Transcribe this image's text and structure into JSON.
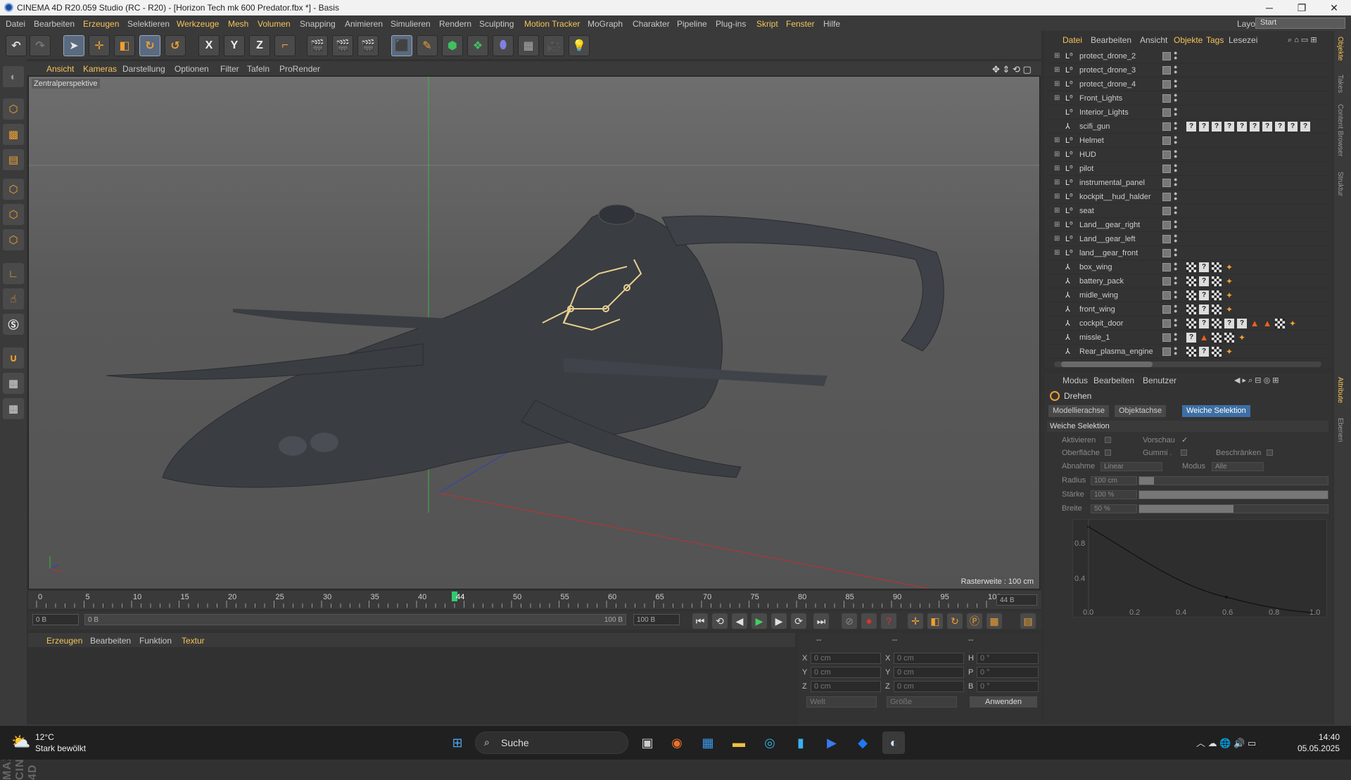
{
  "window": {
    "title": "CINEMA 4D R20.059 Studio (RC - R20) - [Horizon Tech mk 600 Predator.fbx *] - Basis",
    "minimize": "─",
    "maximize": "❐",
    "close": "✕"
  },
  "menu": [
    {
      "label": "Datei",
      "hl": false
    },
    {
      "label": "Bearbeiten",
      "hl": false
    },
    {
      "label": "Erzeugen",
      "hl": true
    },
    {
      "label": "Selektieren",
      "hl": false
    },
    {
      "label": "Werkzeuge",
      "hl": true
    },
    {
      "label": "Mesh",
      "hl": true
    },
    {
      "label": "Volumen",
      "hl": true
    },
    {
      "label": "Snapping",
      "hl": false
    },
    {
      "label": "Animieren",
      "hl": false
    },
    {
      "label": "Simulieren",
      "hl": false
    },
    {
      "label": "Rendern",
      "hl": false
    },
    {
      "label": "Sculpting",
      "hl": false
    },
    {
      "label": "Motion Tracker",
      "hl": true
    },
    {
      "label": "MoGraph",
      "hl": false
    },
    {
      "label": "Charakter",
      "hl": false
    },
    {
      "label": "Pipeline",
      "hl": false
    },
    {
      "label": "Plug-ins",
      "hl": false
    },
    {
      "label": "Skript",
      "hl": true
    },
    {
      "label": "Fenster",
      "hl": true
    },
    {
      "label": "Hilfe",
      "hl": false
    }
  ],
  "layout": {
    "label": "Layout:",
    "value": "Start"
  },
  "toolbar": {
    "axes": [
      "X",
      "Y",
      "Z"
    ]
  },
  "viewport": {
    "menu": [
      "Ansicht",
      "Kameras",
      "Darstellung",
      "Optionen",
      "Filter",
      "Tafeln",
      "ProRender"
    ],
    "camera": "Zentralperspektive",
    "raster": "Rasterweite : 100 cm"
  },
  "timeline": {
    "ticks": [
      "0",
      "5",
      "10",
      "15",
      "20",
      "25",
      "30",
      "35",
      "40",
      "44",
      "50",
      "55",
      "60",
      "65",
      "70",
      "75",
      "80",
      "85",
      "90",
      "95",
      "100"
    ],
    "current_frame": 44,
    "end_field": "44 B"
  },
  "transport": {
    "start": "0 B",
    "range_start": "0 B",
    "range_end": "100 B",
    "end": "100 B"
  },
  "material": {
    "menu": [
      "Erzeugen",
      "Bearbeiten",
      "Funktion",
      "Textur"
    ]
  },
  "coords": {
    "header": [
      "--",
      "--",
      "--"
    ],
    "rows": [
      {
        "a": "X",
        "av": "0 cm",
        "b": "X",
        "bv": "0 cm",
        "c": "H",
        "cv": "0 °"
      },
      {
        "a": "Y",
        "av": "0 cm",
        "b": "Y",
        "bv": "0 cm",
        "c": "P",
        "cv": "0 °"
      },
      {
        "a": "Z",
        "av": "0 cm",
        "b": "Z",
        "bv": "0 cm",
        "c": "B",
        "cv": "0 °"
      }
    ],
    "mode1": "Welt",
    "mode2": "Größe",
    "apply": "Anwenden"
  },
  "objects": {
    "menu": [
      "Datei",
      "Bearbeiten",
      "Ansicht",
      "Objekte",
      "Tags",
      "Lesezei"
    ],
    "menu_hl": [
      "Datei",
      "Objekte",
      "Tags"
    ],
    "rows": [
      {
        "name": "protect_drone_2",
        "icon": "null",
        "expand": true,
        "tags": []
      },
      {
        "name": "protect_drone_3",
        "icon": "null",
        "expand": true,
        "tags": []
      },
      {
        "name": "protect_drone_4",
        "icon": "null",
        "expand": true,
        "tags": []
      },
      {
        "name": "Front_Lights",
        "icon": "null",
        "expand": true,
        "tags": []
      },
      {
        "name": "Interior_Lights",
        "icon": "null",
        "expand": false,
        "tags": []
      },
      {
        "name": "scifi_gun",
        "icon": "poly",
        "expand": false,
        "tags": [
          "q",
          "q",
          "q",
          "q",
          "q",
          "q",
          "q",
          "q",
          "q",
          "q"
        ]
      },
      {
        "name": "Helmet",
        "icon": "null",
        "expand": true,
        "tags": []
      },
      {
        "name": "HUD",
        "icon": "null",
        "expand": true,
        "tags": []
      },
      {
        "name": "pilot",
        "icon": "null",
        "expand": true,
        "tags": []
      },
      {
        "name": "instrumental_panel",
        "icon": "null",
        "expand": true,
        "tags": []
      },
      {
        "name": "kockpit__hud_halder",
        "icon": "null",
        "expand": true,
        "tags": []
      },
      {
        "name": "seat",
        "icon": "null",
        "expand": true,
        "tags": []
      },
      {
        "name": "Land__gear_right",
        "icon": "null",
        "expand": true,
        "tags": []
      },
      {
        "name": "Land__gear_left",
        "icon": "null",
        "expand": true,
        "tags": []
      },
      {
        "name": "land__gear_front",
        "icon": "null",
        "expand": true,
        "tags": []
      },
      {
        "name": "box_wing",
        "icon": "poly",
        "expand": false,
        "tags": [
          "c",
          "q",
          "c",
          "d"
        ]
      },
      {
        "name": "battery_pack",
        "icon": "poly",
        "expand": false,
        "tags": [
          "c",
          "q",
          "c",
          "d"
        ]
      },
      {
        "name": "midle_wing",
        "icon": "poly",
        "expand": false,
        "tags": [
          "c",
          "q",
          "c",
          "d"
        ]
      },
      {
        "name": "front_wing",
        "icon": "poly",
        "expand": false,
        "tags": [
          "c",
          "q",
          "c",
          "d"
        ]
      },
      {
        "name": "cockpit_door",
        "icon": "poly",
        "expand": false,
        "tags": [
          "c",
          "q",
          "c",
          "q",
          "q",
          "t",
          "t",
          "c",
          "d"
        ]
      },
      {
        "name": "missle_1",
        "icon": "poly",
        "expand": false,
        "tags": [
          "q",
          "t",
          "c",
          "c",
          "d"
        ]
      },
      {
        "name": "Rear_plasma_engine",
        "icon": "poly",
        "expand": false,
        "tags": [
          "c",
          "q",
          "c",
          "d"
        ]
      }
    ]
  },
  "attributes": {
    "menu": [
      "Modus",
      "Bearbeiten",
      "Benutzer"
    ],
    "tool": "Drehen",
    "tabs": [
      "Modellierachse",
      "Objektachse",
      "Weiche Selektion"
    ],
    "active_tab": "Weiche Selektion",
    "section": "Weiche Selektion",
    "aktivieren": "Aktivieren",
    "vorschau": "Vorschau",
    "vorschau_check": "✓",
    "oberflaeche": "Oberfläche",
    "gummi": "Gummi .",
    "beschraenken": "Beschränken",
    "abnahme": "Abnahme",
    "abnahme_val": "Linear",
    "modus": "Modus",
    "modus_val": "Alle",
    "radius": "Radius",
    "radius_val": "100 cm",
    "radius_fill": 0.08,
    "staerke": "Stärke",
    "staerke_val": "100 %",
    "staerke_fill": 1.0,
    "breite": "Breite",
    "breite_val": "50 %",
    "breite_fill": 0.5,
    "graph_y": [
      "0.8",
      "0.4"
    ],
    "graph_x": [
      "0.0",
      "0.2",
      "0.4",
      "0.6",
      "0.8",
      "1.0"
    ]
  },
  "side_tabs": [
    "Objekte",
    "Takes",
    "Content Browser",
    "Struktur",
    "Attribute",
    "Ebenen"
  ],
  "taskbar": {
    "temp": "12°C",
    "weather": "Stark bewölkt",
    "search": "Suche",
    "time": "14:40",
    "date": "05.05.2025"
  },
  "colors": {
    "accent": "#f4c35a",
    "selection": "#3d6fa5",
    "timeline_marker": "#2ecc71"
  }
}
